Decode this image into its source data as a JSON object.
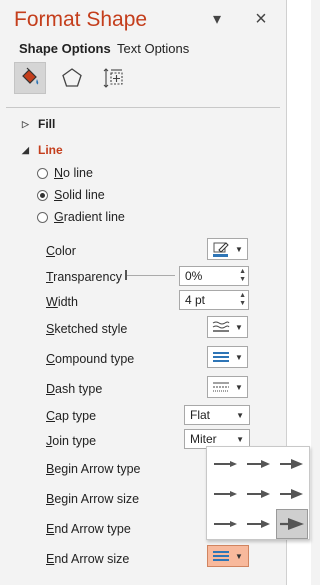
{
  "pane": {
    "title": "Format Shape",
    "close_icon": "×",
    "menu_icon": "▾"
  },
  "tabs": [
    {
      "label": "Shape Options",
      "active": true
    },
    {
      "label": "Text Options",
      "active": false
    }
  ],
  "icons": [
    "fill-line-icon",
    "effects-pentagon-icon",
    "size-properties-icon"
  ],
  "sections": {
    "fill": "Fill",
    "line": "Line"
  },
  "line_options": [
    {
      "label": "No line",
      "selected": false
    },
    {
      "label": "Solid line",
      "selected": true
    },
    {
      "label": "Gradient line",
      "selected": false
    }
  ],
  "props": {
    "color": "Color",
    "transparency": "Transparency",
    "transparency_value": "0%",
    "width": "Width",
    "width_value": "4 pt",
    "sketched": "Sketched style",
    "compound": "Compound type",
    "dash": "Dash type",
    "cap": "Cap type",
    "cap_value": "Flat",
    "join": "Join type",
    "join_value": "Miter",
    "begin_type": "Begin Arrow type",
    "begin_size": "Begin Arrow size",
    "end_type": "End Arrow type",
    "end_size": "End Arrow size"
  },
  "colors": {
    "title": "#c43e1c",
    "accent_blue": "#2e75b6",
    "highlight": "#f8b99c"
  },
  "arrow_size_grid_selected": 9
}
